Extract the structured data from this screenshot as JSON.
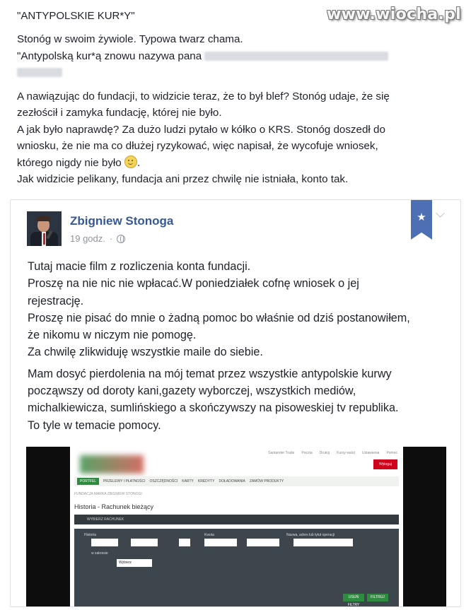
{
  "watermark": "www.wiocha.pl",
  "post": {
    "title": "\"ANTYPOLSKIE KUR*Y\"",
    "lines": [
      "Stonóg w swoim żywiole. Typowa twarz chama.",
      "\"Antypolską kur*ą znowu nazywa pana",
      "A nawiązując do fundacji, to widzicie teraz, że to był blef? Stonóg udaje, że się",
      "zezłościł i zamyka fundację, której nie było.",
      "A jak było naprawdę? Za dużo ludzi pytało w kółko o KRS. Stonóg doszedł do",
      "wniosku, że nie ma co dłużej ryzykować, więc napisał, że wycofuje wniosek,",
      "którego nigdy nie było",
      "Jak widzicie pelikany, fundacja ani przez chwilę nie istniała, konto tak."
    ]
  },
  "shared_post": {
    "author": "Zbigniew Stonoga",
    "time": "19 godz.",
    "bookmark_icon": "star-icon",
    "privacy_icon": "globe-icon",
    "lines": [
      "Tutaj macie film z rozliczenia konta fundacji.",
      "Proszę na nie nic nie wpłacać.W poniedziałek cofnę wniosek o jej",
      "rejestrację.",
      "Proszę nie pisać do mnie o żadną pomoc bo właśnie od dziś postanowiłem,",
      "że nikomu w niczym nie pomogę.",
      "Za chwilę zlikwiduję wszystkie maile do siebie.",
      "Mam dosyć pierdolenia na mój temat przez wszystkie antypolskie kurwy",
      "począwszy od doroty kani,gazety wyborczej, wszystkich mediów,",
      "michalkiewicza, sumlińskiego a skończywszy na pisoweskiej tv republika.",
      "To tyle w temacie pomocy."
    ]
  },
  "embedded": {
    "topnav": [
      "Santander Trade",
      "Poczta",
      "Drukuj",
      "Kursy walut",
      "Ustawienia",
      "Pomoc"
    ],
    "logout": "Wyloguj",
    "menu": [
      "PORTFEL",
      "PRZELEWY I PŁATNOŚCI",
      "OSZCZĘDNOŚCI",
      "KARTY",
      "KREDYTY",
      "DOŁADOWANIA",
      "ZAMÓW PRODUKTY"
    ],
    "breadcrumb": "FUNDACJA MARKA ZBIGNIEW STONOGI",
    "title": "Historia - Rachunek bieżący",
    "account_label": "WYBIERZ RACHUNEK",
    "filter_labels": [
      "Historia",
      "Kwota",
      "Nazwa, adres lub tytuł operacji"
    ],
    "period_label": "w zakresie",
    "select_value": "Wybierz",
    "filter_button": "FILTRUJ",
    "clear_button": "USUŃ FILTRY"
  }
}
